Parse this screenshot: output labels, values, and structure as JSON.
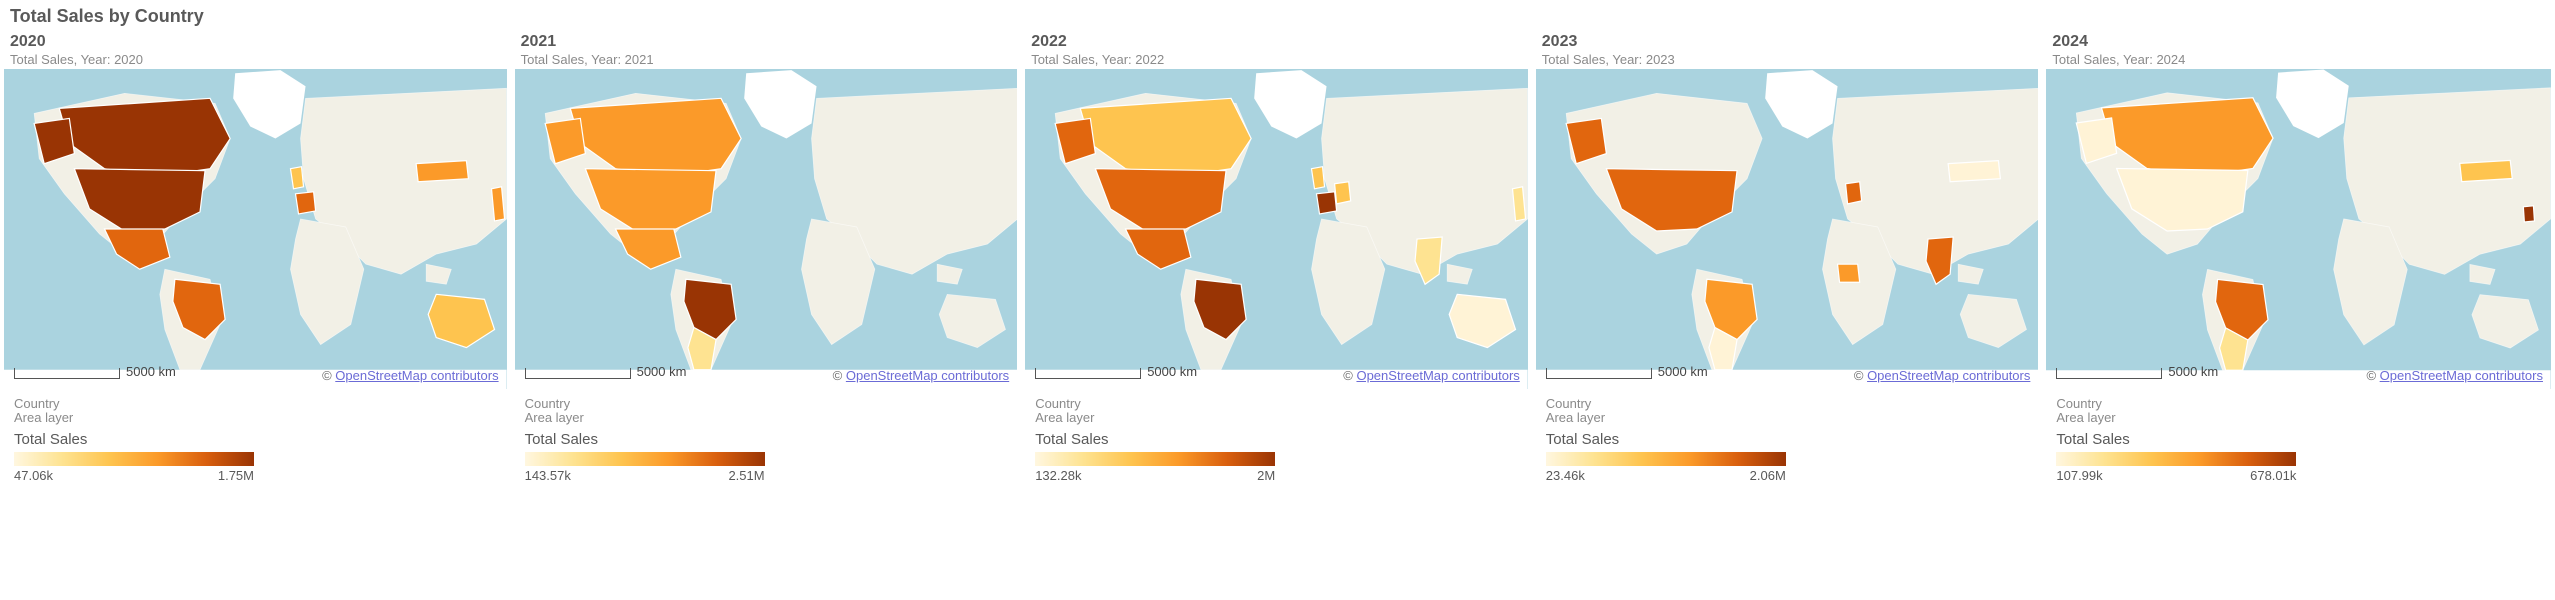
{
  "title": "Total Sales by Country",
  "chart_data": {
    "type": "heatmap",
    "facets_by": "Year",
    "geo_field": "Country",
    "measure": "Total Sales",
    "legend_label": "Total Sales",
    "area_layer_dim": "Country",
    "area_layer_sub": "Area layer",
    "attribution_prefix": "© ",
    "attribution_link": "OpenStreetMap contributors",
    "scale_label": "5000 km",
    "color_scale": {
      "type": "sequential",
      "palette": [
        "#fff7e0",
        "#fee391",
        "#fec44f",
        "#fb9a29",
        "#d95f0e",
        "#993404"
      ]
    },
    "panels": [
      {
        "year": "2020",
        "subtitle": "Total Sales, Year: 2020",
        "legend_min": "47.06k",
        "legend_max": "1.75M",
        "range": [
          47060,
          1750000
        ],
        "countries": {
          "Canada": {
            "level": 6
          },
          "USA": {
            "level": 6
          },
          "Mexico": {
            "level": 5
          },
          "Brazil": {
            "level": 5
          },
          "Argentina": {
            "level": 0
          },
          "UK": {
            "level": 3
          },
          "France": {
            "level": 5
          },
          "Germany": {
            "level": 0
          },
          "Nigeria": {
            "level": 0
          },
          "India": {
            "level": 0
          },
          "China": {
            "level": 0
          },
          "Japan": {
            "level": 4
          },
          "SouthKorea": {
            "level": 0
          },
          "Mongolia": {
            "level": 4
          },
          "Australia": {
            "level": 3
          }
        }
      },
      {
        "year": "2021",
        "subtitle": "Total Sales, Year: 2021",
        "legend_min": "143.57k",
        "legend_max": "2.51M",
        "range": [
          143570,
          2510000
        ],
        "countries": {
          "Canada": {
            "level": 4
          },
          "USA": {
            "level": 4
          },
          "Mexico": {
            "level": 4
          },
          "Brazil": {
            "level": 6
          },
          "Argentina": {
            "level": 2
          },
          "UK": {
            "level": 0
          },
          "France": {
            "level": 0
          },
          "Germany": {
            "level": 0
          },
          "Nigeria": {
            "level": 0
          },
          "India": {
            "level": 0
          },
          "China": {
            "level": 0
          },
          "Japan": {
            "level": 0
          },
          "SouthKorea": {
            "level": 0
          },
          "Mongolia": {
            "level": 0
          },
          "Australia": {
            "level": 0
          }
        }
      },
      {
        "year": "2022",
        "subtitle": "Total Sales, Year: 2022",
        "legend_min": "132.28k",
        "legend_max": "2M",
        "range": [
          132280,
          2000000
        ],
        "countries": {
          "Canada": {
            "level": 3
          },
          "USA": {
            "level": 5
          },
          "Mexico": {
            "level": 5
          },
          "Brazil": {
            "level": 6
          },
          "Argentina": {
            "level": 0
          },
          "UK": {
            "level": 3
          },
          "France": {
            "level": 6
          },
          "Germany": {
            "level": 3
          },
          "Nigeria": {
            "level": 0
          },
          "India": {
            "level": 2
          },
          "China": {
            "level": 0
          },
          "Japan": {
            "level": 2
          },
          "SouthKorea": {
            "level": 0
          },
          "Mongolia": {
            "level": 0
          },
          "Australia": {
            "level": 1
          }
        }
      },
      {
        "year": "2023",
        "subtitle": "Total Sales, Year: 2023",
        "legend_min": "23.46k",
        "legend_max": "2.06M",
        "range": [
          23460,
          2060000
        ],
        "countries": {
          "Canada": {
            "level": 0
          },
          "USA": {
            "level": 5
          },
          "Mexico": {
            "level": 0
          },
          "Brazil": {
            "level": 4
          },
          "Argentina": {
            "level": 1
          },
          "UK": {
            "level": 0
          },
          "France": {
            "level": 0
          },
          "Germany": {
            "level": 5
          },
          "Nigeria": {
            "level": 4
          },
          "India": {
            "level": 5
          },
          "China": {
            "level": 0
          },
          "Japan": {
            "level": 0
          },
          "SouthKorea": {
            "level": 0
          },
          "Mongolia": {
            "level": 1
          },
          "Australia": {
            "level": 0
          }
        }
      },
      {
        "year": "2024",
        "subtitle": "Total Sales, Year: 2024",
        "legend_min": "107.99k",
        "legend_max": "678.01k",
        "range": [
          107990,
          678010
        ],
        "countries": {
          "Canada": {
            "level": 4
          },
          "USA": {
            "level": 1
          },
          "Mexico": {
            "level": 0
          },
          "Brazil": {
            "level": 5
          },
          "Argentina": {
            "level": 2
          },
          "UK": {
            "level": 0
          },
          "France": {
            "level": 0
          },
          "Germany": {
            "level": 0
          },
          "Nigeria": {
            "level": 0
          },
          "India": {
            "level": 0
          },
          "China": {
            "level": 0
          },
          "Japan": {
            "level": 0
          },
          "SouthKorea": {
            "level": 6
          },
          "Mongolia": {
            "level": 3
          },
          "Australia": {
            "level": 0
          }
        }
      }
    ]
  }
}
